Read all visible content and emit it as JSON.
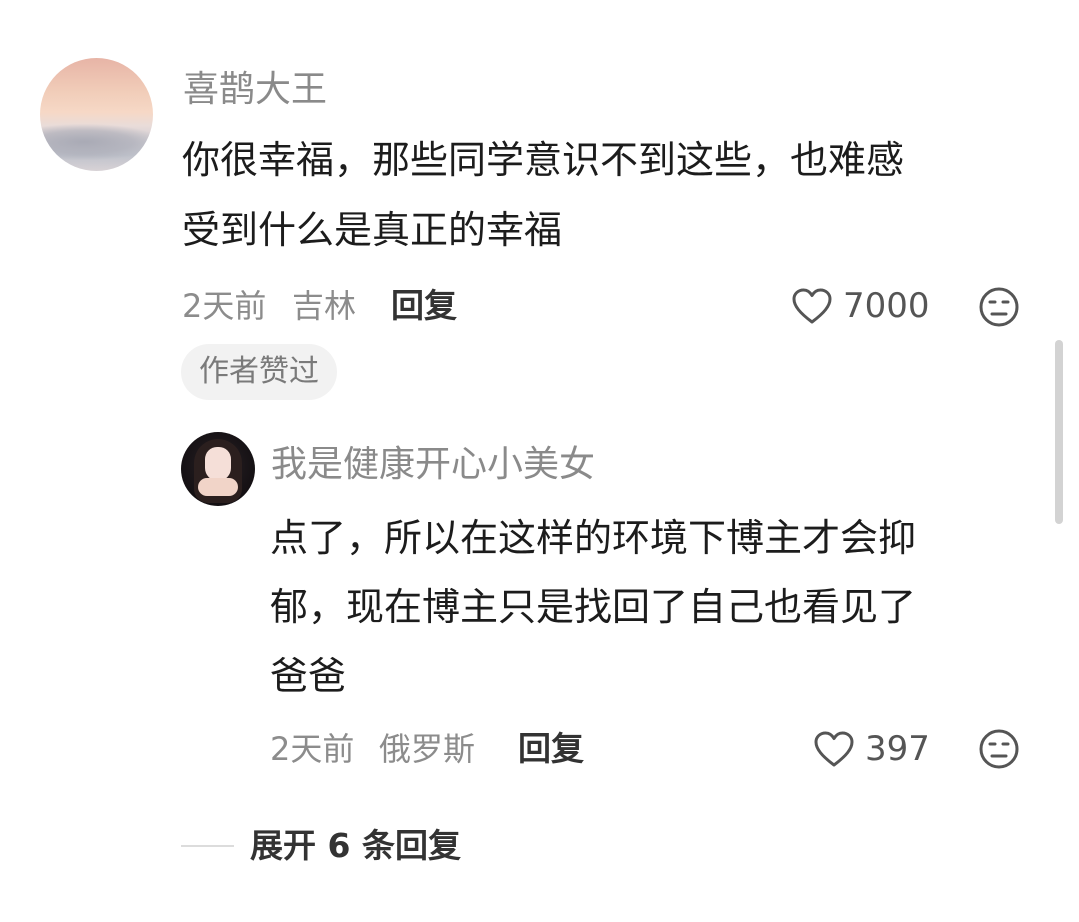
{
  "comments": [
    {
      "username": "喜鹊大王",
      "content_lines": [
        "你很幸福，那些同学意识不到这些，也难感",
        "受到什么是真正的幸福"
      ],
      "time": "2天前",
      "location": "吉林",
      "reply_label": "回复",
      "likes": "7000",
      "badge": "作者赞过"
    }
  ],
  "replies": [
    {
      "username": "我是健康开心小美女",
      "content_lines": [
        "点了，所以在这样的环境下博主才会抑",
        "郁，现在博主只是找回了自己也看见了",
        "爸爸"
      ],
      "time": "2天前",
      "location": "俄罗斯",
      "reply_label": "回复",
      "likes": "397"
    }
  ],
  "expand_label": "展开 6 条回复",
  "icons": {
    "like": "heart-outline-icon",
    "dislike": "frown-face-icon"
  }
}
